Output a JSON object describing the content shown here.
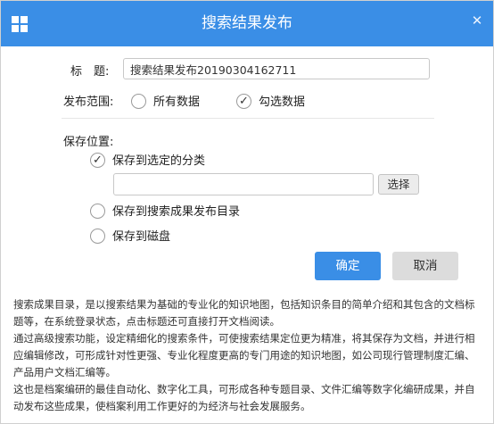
{
  "window": {
    "title": "搜索结果发布",
    "app_icon": "grid-icon",
    "close_icon": "close-icon",
    "close_glyph": "✕"
  },
  "form": {
    "title_label": "标　题:",
    "title_value": "搜索结果发布20190304162711",
    "scope_label": "发布范围:",
    "scope_options": [
      {
        "label": "所有数据",
        "checked": false
      },
      {
        "label": "勾选数据",
        "checked": true
      }
    ],
    "save_location_label": "保存位置:",
    "save_options": [
      {
        "label": "保存到选定的分类",
        "checked": true
      },
      {
        "label": "保存到搜索成果发布目录",
        "checked": false
      },
      {
        "label": "保存到磁盘",
        "checked": false
      }
    ],
    "category_value": "",
    "select_button_label": "选择"
  },
  "actions": {
    "ok_label": "确定",
    "cancel_label": "取消"
  },
  "description": [
    "搜索成果目录，是以搜索结果为基础的专业化的知识地图，包括知识条目的简单介绍和其包含的文档标题等，在系统登录状态，点击标题还可直接打开文档阅读。",
    "通过高级搜索功能，设定精细化的搜索条件，可使搜索结果定位更为精准，将其保存为文档，并进行相应编辑修改，可形成针对性更强、专业化程度更高的专门用途的知识地图，如公司现行管理制度汇编、产品用户文档汇编等。",
    "这也是档案编研的最佳自动化、数字化工具，可形成各种专题目录、文件汇编等数字化编研成果，并自动发布这些成果，使档案利用工作更好的为经济与社会发展服务。"
  ],
  "colors": {
    "accent": "#3a8ee6",
    "cancel_bg": "#dcdcdc"
  }
}
